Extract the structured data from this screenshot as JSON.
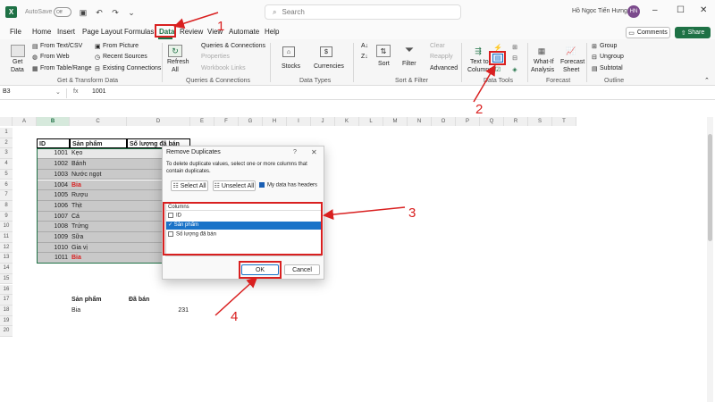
{
  "titlebar": {
    "logo": "X",
    "autosave_label": "AutoSave",
    "autosave_state": "Off",
    "search_placeholder": "Search",
    "user_name": "Hồ Ngọc Tiến Hưng",
    "user_initials": "HN"
  },
  "menu": {
    "items": [
      "File",
      "Home",
      "Insert",
      "Page Layout",
      "Formulas",
      "Data",
      "Review",
      "View",
      "Automate",
      "Help"
    ],
    "active": "Data",
    "comments_label": "Comments",
    "share_label": "Share"
  },
  "ribbon": {
    "get_data_line1": "Get",
    "get_data_line2": "Data",
    "from_text_csv": "From Text/CSV",
    "from_web": "From Web",
    "from_table_range": "From Table/Range",
    "from_picture": "From Picture",
    "recent_sources": "Recent Sources",
    "existing_connections": "Existing Connections",
    "group_get_transform": "Get & Transform Data",
    "refresh_all_line1": "Refresh",
    "refresh_all_line2": "All",
    "queries_connections": "Queries & Connections",
    "properties": "Properties",
    "workbook_links": "Workbook Links",
    "group_queries": "Queries & Connections",
    "stocks": "Stocks",
    "currencies": "Currencies",
    "group_data_types": "Data Types",
    "sort": "Sort",
    "filter": "Filter",
    "clear": "Clear",
    "reapply": "Reapply",
    "advanced": "Advanced",
    "group_sort_filter": "Sort & Filter",
    "text_to_columns_line1": "Text to",
    "text_to_columns_line2": "Columns",
    "group_data_tools": "Data Tools",
    "what_if_line1": "What-If",
    "what_if_line2": "Analysis",
    "forecast_line1": "Forecast",
    "forecast_line2": "Sheet",
    "group_forecast": "Forecast",
    "group_btn": "Group",
    "ungroup_btn": "Ungroup",
    "subtotal": "Subtotal",
    "group_outline": "Outline"
  },
  "formula_bar": {
    "name_box": "B3",
    "fx": "fx",
    "value": "1001"
  },
  "sheet": {
    "columns": [
      "A",
      "B",
      "C",
      "D",
      "E",
      "F",
      "G",
      "H",
      "I",
      "J",
      "K",
      "L",
      "M",
      "N",
      "O",
      "P",
      "Q",
      "R",
      "S",
      "T"
    ],
    "rows": [
      "1",
      "2",
      "3",
      "4",
      "5",
      "6",
      "7",
      "8",
      "9",
      "10",
      "11",
      "12",
      "13",
      "14",
      "15",
      "16",
      "17",
      "18",
      "19",
      "20"
    ],
    "header_id": "ID",
    "header_product": "Sản phẩm",
    "header_qty": "Số lượng đã bán",
    "table": [
      {
        "id": "1001",
        "product": "Kẹo"
      },
      {
        "id": "1002",
        "product": "Bánh"
      },
      {
        "id": "1003",
        "product": "Nước ngọt"
      },
      {
        "id": "1004",
        "product": "Bia"
      },
      {
        "id": "1005",
        "product": "Rượu"
      },
      {
        "id": "1006",
        "product": "Thịt"
      },
      {
        "id": "1007",
        "product": "Cá"
      },
      {
        "id": "1008",
        "product": "Trứng"
      },
      {
        "id": "1009",
        "product": "Sữa"
      },
      {
        "id": "1010",
        "product": "Gia vị"
      },
      {
        "id": "1011",
        "product": "Bia"
      }
    ],
    "summary_header_product": "Sản phẩm",
    "summary_header_sold": "Đã bán",
    "summary_product": "Bia",
    "summary_sold": "231"
  },
  "dialog": {
    "title": "Remove Duplicates",
    "help": "?",
    "close": "✕",
    "instruction": "To delete duplicate values, select one or more columns that contain duplicates.",
    "select_all": "Select All",
    "unselect_all": "Unselect All",
    "has_headers": "My data has headers",
    "columns_header": "Columns",
    "columns": [
      {
        "label": "ID",
        "checked": false
      },
      {
        "label": "Sản phẩm",
        "checked": true
      },
      {
        "label": "Số lượng đã bán",
        "checked": false
      }
    ],
    "ok": "OK",
    "cancel": "Cancel"
  },
  "annotations": {
    "step1": "1",
    "step2": "2",
    "step3": "3",
    "step4": "4",
    "color": "#d92020"
  },
  "colors": {
    "excel_green": "#1e7145",
    "highlight_red": "#d92020",
    "table_fill": "#c9c9c9",
    "selection_blue": "#1a73c8"
  }
}
